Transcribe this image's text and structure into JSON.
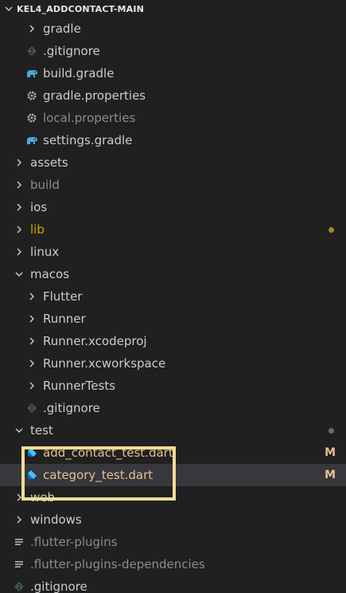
{
  "explorer": {
    "title": "KEL4_ADDCONTACT-MAIN",
    "colors": {
      "folder_text": "#cccccc",
      "ignored_text": "#8b8b8b",
      "modified_text": "#e2c08d",
      "lib_text": "#cca700",
      "highlight_border": "#f1dd93"
    },
    "rows": [
      {
        "label": "gradle",
        "kind": "folder",
        "expanded": false,
        "indent": 1,
        "style": "normal"
      },
      {
        "label": ".gitignore",
        "kind": "file",
        "icon": "git-icon",
        "indent": 1,
        "style": "normal"
      },
      {
        "label": "build.gradle",
        "kind": "file",
        "icon": "gradle-elephant-icon",
        "indent": 1,
        "style": "normal"
      },
      {
        "label": "gradle.properties",
        "kind": "file",
        "icon": "gear-icon",
        "indent": 1,
        "style": "normal"
      },
      {
        "label": "local.properties",
        "kind": "file",
        "icon": "gear-icon",
        "indent": 1,
        "style": "dim"
      },
      {
        "label": "settings.gradle",
        "kind": "file",
        "icon": "gradle-elephant-icon",
        "indent": 1,
        "style": "normal"
      },
      {
        "label": "assets",
        "kind": "folder",
        "expanded": false,
        "indent": 0,
        "style": "normal"
      },
      {
        "label": "build",
        "kind": "folder",
        "expanded": false,
        "indent": 0,
        "style": "dim"
      },
      {
        "label": "ios",
        "kind": "folder",
        "expanded": false,
        "indent": 0,
        "style": "normal"
      },
      {
        "label": "lib",
        "kind": "folder",
        "expanded": false,
        "indent": 0,
        "style": "lib",
        "dot": "#a08a2c"
      },
      {
        "label": "linux",
        "kind": "folder",
        "expanded": false,
        "indent": 0,
        "style": "normal"
      },
      {
        "label": "macos",
        "kind": "folder",
        "expanded": true,
        "indent": 0,
        "style": "normal"
      },
      {
        "label": "Flutter",
        "kind": "folder",
        "expanded": false,
        "indent": 1,
        "style": "normal"
      },
      {
        "label": "Runner",
        "kind": "folder",
        "expanded": false,
        "indent": 1,
        "style": "normal"
      },
      {
        "label": "Runner.xcodeproj",
        "kind": "folder",
        "expanded": false,
        "indent": 1,
        "style": "normal"
      },
      {
        "label": "Runner.xcworkspace",
        "kind": "folder",
        "expanded": false,
        "indent": 1,
        "style": "normal"
      },
      {
        "label": "RunnerTests",
        "kind": "folder",
        "expanded": false,
        "indent": 1,
        "style": "normal"
      },
      {
        "label": ".gitignore",
        "kind": "file",
        "icon": "git-icon",
        "indent": 1,
        "style": "normal"
      },
      {
        "label": "test",
        "kind": "folder",
        "expanded": true,
        "indent": 0,
        "style": "normal",
        "dot": "#6b6b6b"
      },
      {
        "label": "add_contact_test.dart",
        "kind": "file",
        "icon": "dart-icon",
        "indent": 1,
        "style": "modified",
        "badge": "M"
      },
      {
        "label": "category_test.dart",
        "kind": "file",
        "icon": "dart-icon",
        "indent": 1,
        "style": "modified",
        "badge": "M",
        "selected": true
      },
      {
        "label": "web",
        "kind": "folder",
        "expanded": false,
        "indent": 0,
        "style": "normal"
      },
      {
        "label": "windows",
        "kind": "folder",
        "expanded": false,
        "indent": 0,
        "style": "normal"
      },
      {
        "label": ".flutter-plugins",
        "kind": "file",
        "icon": "lines-icon",
        "indent": 0,
        "style": "dim"
      },
      {
        "label": ".flutter-plugins-dependencies",
        "kind": "file",
        "icon": "lines-icon",
        "indent": 0,
        "style": "dim"
      },
      {
        "label": ".gitignore",
        "kind": "file",
        "icon": "git-icon",
        "indent": 0,
        "style": "normal"
      }
    ]
  }
}
